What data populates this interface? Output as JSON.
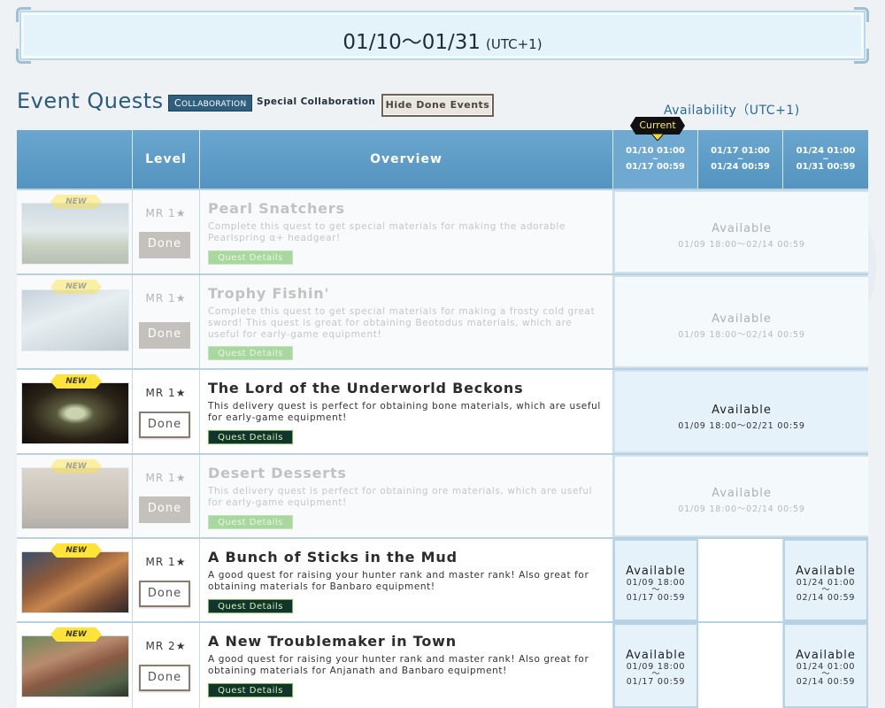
{
  "banner": {
    "date": "01/10～01/31",
    "tz": "(UTC+1)"
  },
  "header": {
    "title": "Event Quests",
    "collab_tag": "Collaboration",
    "special_label": "Special Collaboration",
    "hide_button": "Hide Done Events",
    "availability_label": "Availability（UTC+1)",
    "current_badge": "Current"
  },
  "columns": {
    "level": "Level",
    "overview": "Overview",
    "dates": [
      {
        "start": "01/10 01:00",
        "tilde": "~",
        "end": "01/17 00:59"
      },
      {
        "start": "01/17 01:00",
        "tilde": "~",
        "end": "01/24 00:59"
      },
      {
        "start": "01/24 01:00",
        "tilde": "~",
        "end": "01/31 00:59"
      }
    ]
  },
  "new_label": "NEW",
  "done_label": "Done",
  "details_label": "Quest Details",
  "quests": [
    {
      "level": "MR 1★",
      "title": "Pearl Snatchers",
      "desc": "Complete this quest to get special materials for making the adorable Pearlspring α+ headgear!",
      "avail_title": "Available",
      "avail_range": "01/09 18:00～02/14 00:59"
    },
    {
      "level": "MR 1★",
      "title": "Trophy Fishin'",
      "desc": "Complete this quest to get special materials for making a frosty cold great sword! This quest is great for obtaining Beotodus materials, which are useful for early-game equipment!",
      "avail_title": "Available",
      "avail_range": "01/09 18:00～02/14 00:59"
    },
    {
      "level": "MR 1★",
      "title": "The Lord of the Underworld Beckons",
      "desc": "This delivery quest is perfect for obtaining bone materials, which are useful for early-game equipment!",
      "avail_title": "Available",
      "avail_range": "01/09 18:00～02/21 00:59"
    },
    {
      "level": "MR 1★",
      "title": "Desert Desserts",
      "desc": "This delivery quest is perfect for obtaining ore materials, which are useful for early-game equipment!",
      "avail_title": "Available",
      "avail_range": "01/09 18:00～02/14 00:59"
    },
    {
      "level": "MR 1★",
      "title": "A Bunch of Sticks in the Mud",
      "desc": "A good quest for raising your hunter rank and master rank! Also great for obtaining materials for Banbaro equipment!",
      "split": [
        {
          "title": "Available",
          "start": "01/09 18:00",
          "tilde": "～",
          "end": "01/17 00:59"
        },
        {
          "title": "Available",
          "start": "01/24 01:00",
          "tilde": "～",
          "end": "02/14 00:59"
        }
      ]
    },
    {
      "level": "MR 2★",
      "title": "A New Troublemaker in Town",
      "desc": "A good quest for raising your hunter rank and master rank! Also great for obtaining materials for Anjanath and Banbaro equipment!",
      "split": [
        {
          "title": "Available",
          "start": "01/09 18:00",
          "tilde": "～",
          "end": "01/17 00:59"
        },
        {
          "title": "Available",
          "start": "01/24 01:00",
          "tilde": "～",
          "end": "02/14 00:59"
        }
      ]
    }
  ]
}
